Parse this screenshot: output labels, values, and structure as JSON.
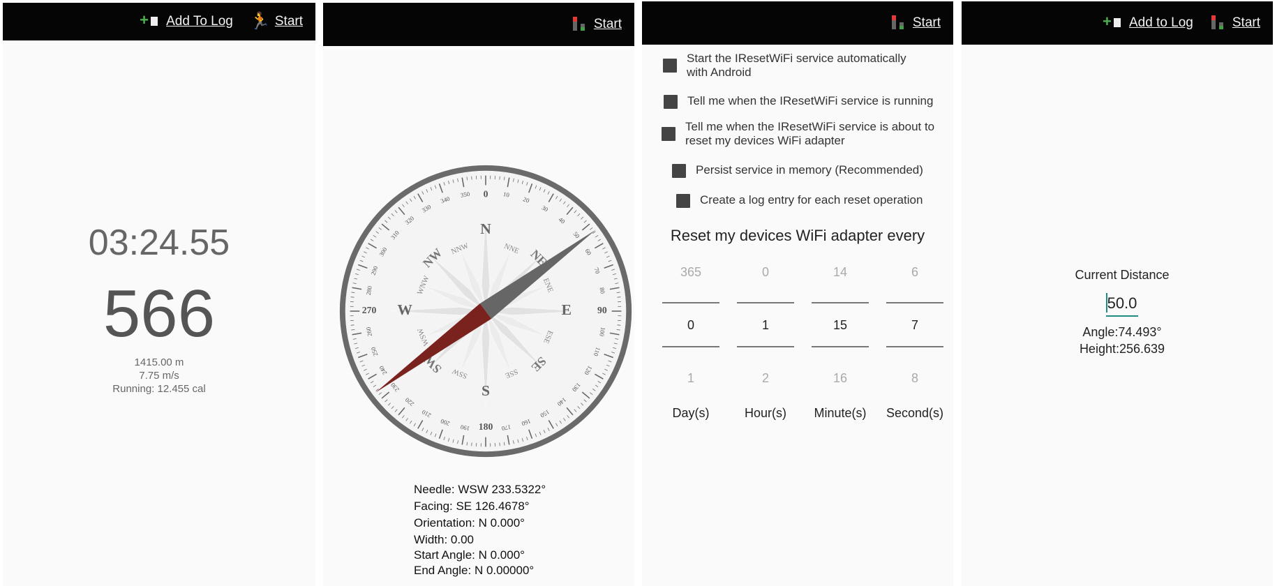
{
  "panel1": {
    "actions": {
      "add_to_log": "Add To Log",
      "start": "Start"
    },
    "timer": "03:24.55",
    "count": "566",
    "distance": "1415.00 m",
    "speed": "7.75 m/s",
    "calories": "Running: 12.455 cal"
  },
  "panel2": {
    "actions": {
      "start": "Start"
    },
    "compass": {
      "needle_deg": 233.5322,
      "facing_deg": 126.4678,
      "cardinal": [
        "N",
        "E",
        "S",
        "W"
      ],
      "intercardinal": [
        "NE",
        "SE",
        "SW",
        "NW"
      ],
      "minor": [
        "NNE",
        "ENE",
        "ESE",
        "SSE",
        "SSW",
        "WSW",
        "WNW",
        "NNW"
      ],
      "degree_labels": [
        "0",
        "10",
        "20",
        "30",
        "40",
        "50",
        "60",
        "70",
        "80",
        "90",
        "100",
        "110",
        "120",
        "130",
        "140",
        "150",
        "160",
        "170",
        "180",
        "190",
        "200",
        "210",
        "220",
        "230",
        "240",
        "250",
        "260",
        "270",
        "280",
        "290",
        "300",
        "310",
        "320",
        "330",
        "340",
        "350"
      ]
    },
    "readouts": {
      "needle": "Needle: WSW 233.5322°",
      "facing": "Facing: SE 126.4678°",
      "orientation": "Orientation: N 0.000°",
      "width": "Width: 0.00",
      "start_angle": "Start Angle: N 0.000°",
      "end_angle": "End Angle: N 0.00000°"
    }
  },
  "panel3": {
    "actions": {
      "start": "Start"
    },
    "options": [
      "Start the IResetWiFi service automatically with Android",
      "Tell me when the IResetWiFi service is running",
      "Tell me when the IResetWiFi service is about to reset my devices WiFi adapter",
      "Persist service in memory (Recommended)",
      "Create a log entry for each reset operation"
    ],
    "reset_title": "Reset my devices WiFi adapter every",
    "pickers": [
      {
        "prev": "365",
        "value": "0",
        "next": "1",
        "unit": "Day(s)"
      },
      {
        "prev": "0",
        "value": "1",
        "next": "2",
        "unit": "Hour(s)"
      },
      {
        "prev": "14",
        "value": "15",
        "next": "16",
        "unit": "Minute(s)"
      },
      {
        "prev": "6",
        "value": "7",
        "next": "8",
        "unit": "Second(s)"
      }
    ]
  },
  "panel4": {
    "actions": {
      "add_to_log": "Add to Log",
      "start": "Start"
    },
    "current_distance_label": "Current Distance",
    "current_distance_value": "50.0",
    "angle": "Angle:74.493°",
    "height": "Height:256.639"
  }
}
